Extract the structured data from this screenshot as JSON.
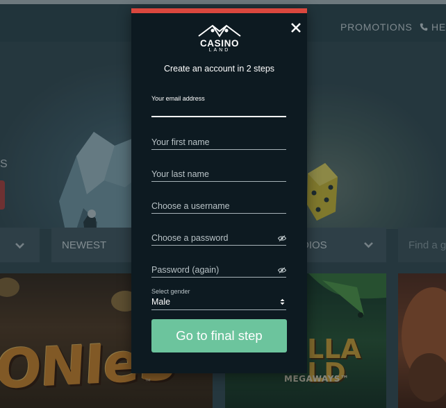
{
  "header": {
    "nav_promotions": "PROMOTIONS",
    "nav_help": "HE",
    "phone_icon": "phone-icon"
  },
  "hero": {
    "partial_text": "S"
  },
  "filters": {
    "newest": "NEWEST",
    "studios": "DIOS",
    "search_placeholder": "Find a ga",
    "chevron_icon": "chevron-down-icon"
  },
  "games": {
    "goonies_title": "ONIeS",
    "goonies_tm": "™",
    "gorilla_title_line1": "LLA",
    "gorilla_title_line2": "LD",
    "megaways": "MEGAWAYS™"
  },
  "modal": {
    "accent_color": "#d9473e",
    "logo_main": "CASINO",
    "logo_sub": "LAND",
    "subtitle": "Create an account in 2 steps",
    "email_label": "Your email address",
    "first_name_placeholder": "Your first name",
    "last_name_placeholder": "Your last name",
    "username_placeholder": "Choose a username",
    "password_placeholder": "Choose a password",
    "password_again_placeholder": "Password (again)",
    "gender_label": "Select gender",
    "gender_value": "Male",
    "submit_label": "Go to final step",
    "submit_color": "#6cc49d"
  }
}
